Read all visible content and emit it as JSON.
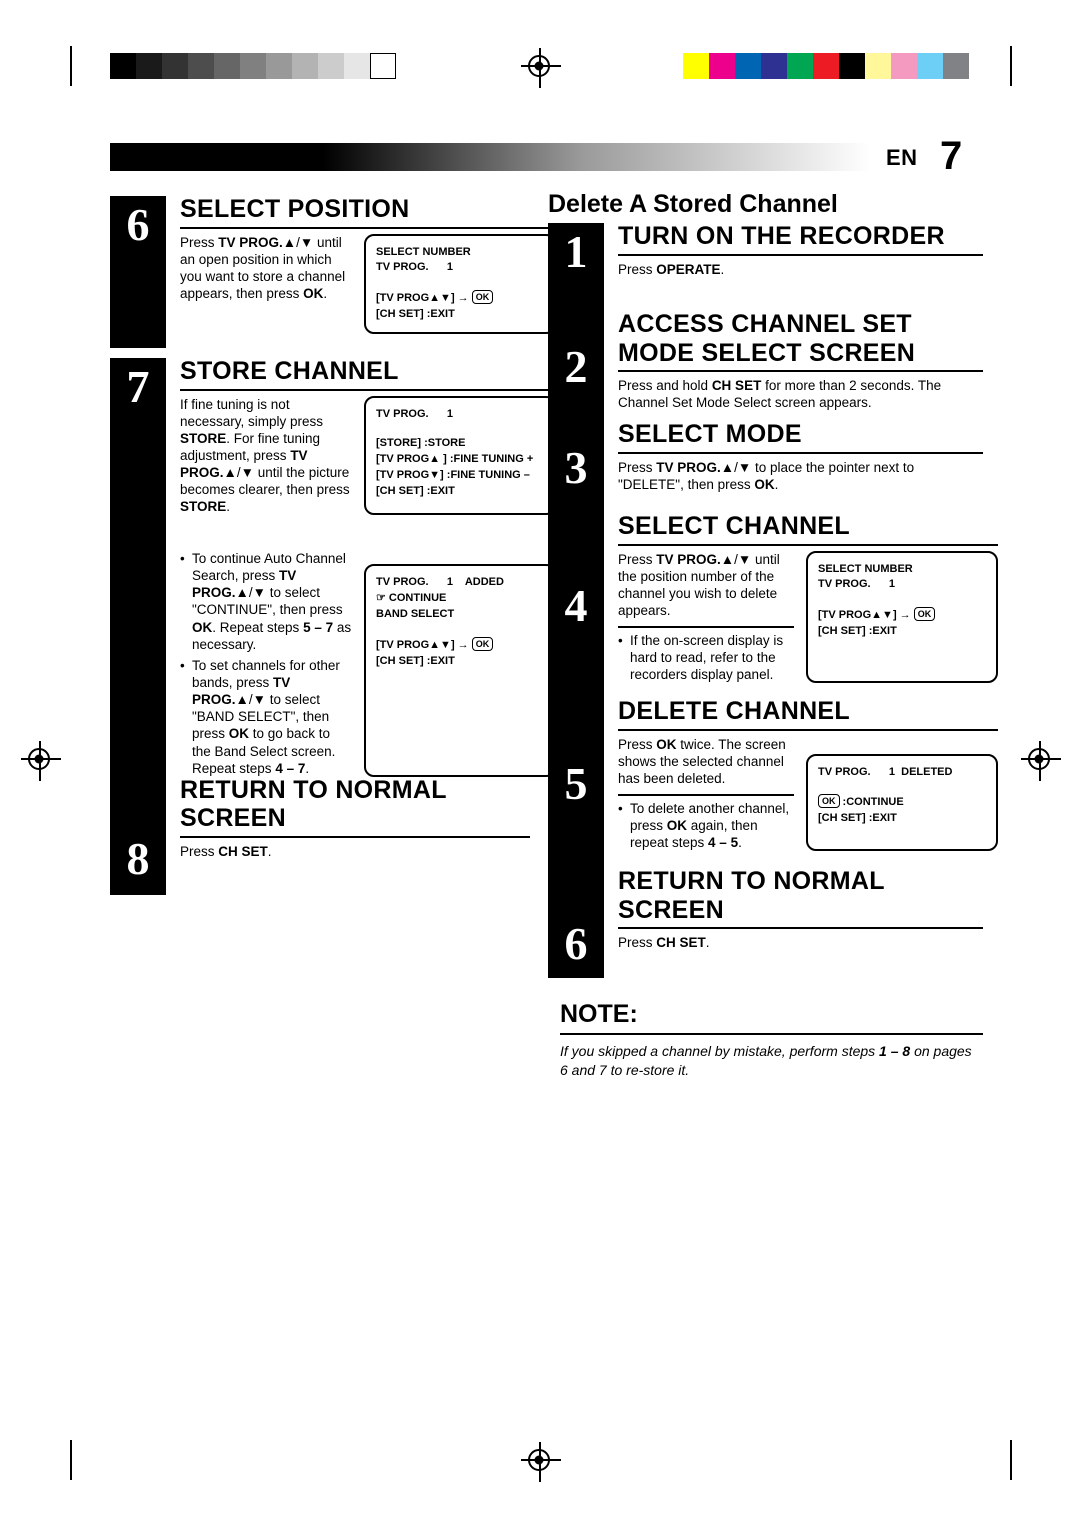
{
  "page": {
    "header_label": "EN",
    "header_number": "7"
  },
  "left_column": {
    "steps": [
      {
        "num": "6",
        "title": "SELECT POSITION",
        "text_html": "Press <b>TV PROG.</b>▲/▼ until an open position in which you want to store a channel appears, then press <b>OK</b>.",
        "osd": {
          "line1": "SELECT NUMBER",
          "line2": "TV PROG.      1",
          "line3": "[TV PROG▲▼] → OK",
          "line4": "[CH SET] :EXIT"
        }
      },
      {
        "num": "7",
        "title": "STORE CHANNEL",
        "text_html": "If fine tuning is not necessary, simply press <b>STORE</b>. For fine tuning adjustment, press <b>TV PROG.</b>▲/▼ until the picture becomes clearer, then press <b>STORE</b>.",
        "osd": {
          "line1": "TV PROG.      1",
          "line2": "[STORE] :STORE",
          "line3": "[TV PROG▲ ] :FINE TUNING +",
          "line4": "[TV PROG▼] :FINE TUNING –",
          "line5": "[CH SET] :EXIT"
        }
      }
    ],
    "bullets": [
      "To continue Auto Channel Search, press <b>TV PROG.</b>▲/▼ to select \"CONTINUE\", then press <b>OK</b>. Repeat steps <b>5 – 7</b> as necessary.",
      "To set channels for other bands, press <b>TV PROG.</b>▲/▼ to select \"BAND SELECT\", then press <b>OK</b> to go back to the Band Select screen. Repeat steps <b>4 – 7</b>."
    ],
    "bullet_osd": {
      "line1": "TV PROG.      1    ADDED",
      "line2": "☞ CONTINUE",
      "line3": "BAND SELECT",
      "line4": "[TV PROG▲▼] → OK",
      "line5": "[CH SET] :EXIT"
    },
    "final_step": {
      "num": "8",
      "title_line1": "RETURN TO NORMAL",
      "title_line2": "SCREEN",
      "text_html": "Press <b>CH SET</b>."
    }
  },
  "right_column": {
    "section_title": "Delete A Stored Channel",
    "steps": [
      {
        "num": "1",
        "title": "TURN ON THE RECORDER",
        "text_html": "Press <b>OPERATE</b>."
      },
      {
        "num": "2",
        "title_line1": "ACCESS CHANNEL SET",
        "title_line2": "MODE SELECT SCREEN",
        "text_html": "Press and hold <b>CH SET</b> for more than 2 seconds. The Channel Set Mode Select screen appears."
      },
      {
        "num": "3",
        "title": "SELECT MODE",
        "text_html": "Press <b>TV PROG.</b>▲/▼ to place the pointer next to \"DELETE\", then press <b>OK</b>."
      },
      {
        "num": "4",
        "title": "SELECT CHANNEL",
        "text_html": "Press <b>TV PROG.</b>▲/▼ until the position number of the channel you wish to delete appears.",
        "bullet": "If the on-screen display is hard to read, refer to the recorders display panel.",
        "osd": {
          "line1": "SELECT NUMBER",
          "line2": "TV PROG.      1",
          "line3": "[TV PROG▲▼] → OK",
          "line4": "[CH SET] :EXIT"
        }
      },
      {
        "num": "5",
        "title": "DELETE CHANNEL",
        "text_html": "Press <b>OK</b> twice. The screen shows the selected channel has been deleted.",
        "bullet": "To delete another channel, press <b>OK</b> again, then repeat steps <b>4 – 5</b>.",
        "osd": {
          "line1": "TV PROG.      1  DELETED",
          "line2": "OK :CONTINUE",
          "line3": "[CH SET] :EXIT"
        }
      },
      {
        "num": "6",
        "title_line1": "RETURN TO NORMAL",
        "title_line2": "SCREEN",
        "text_html": "Press <b>CH SET</b>."
      }
    ],
    "note": {
      "heading": "NOTE:",
      "text_html": "If you skipped a channel by mistake, perform steps <b>1 – 8</b> on pages 6 and 7 to re-store it."
    }
  },
  "printer_marks": {
    "grayscale_swatches": [
      "#000000",
      "#1a1a1a",
      "#333333",
      "#4d4d4d",
      "#666666",
      "#808080",
      "#999999",
      "#b3b3b3",
      "#cccccc",
      "#e6e6e6",
      "#ffffff"
    ],
    "color_swatches": [
      "#ffff00",
      "#ec008c",
      "#0066b3",
      "#2e3192",
      "#00a651",
      "#ed1c24",
      "#000000",
      "#fff79a",
      "#f49ac1",
      "#6dcff6",
      "#808285"
    ]
  }
}
